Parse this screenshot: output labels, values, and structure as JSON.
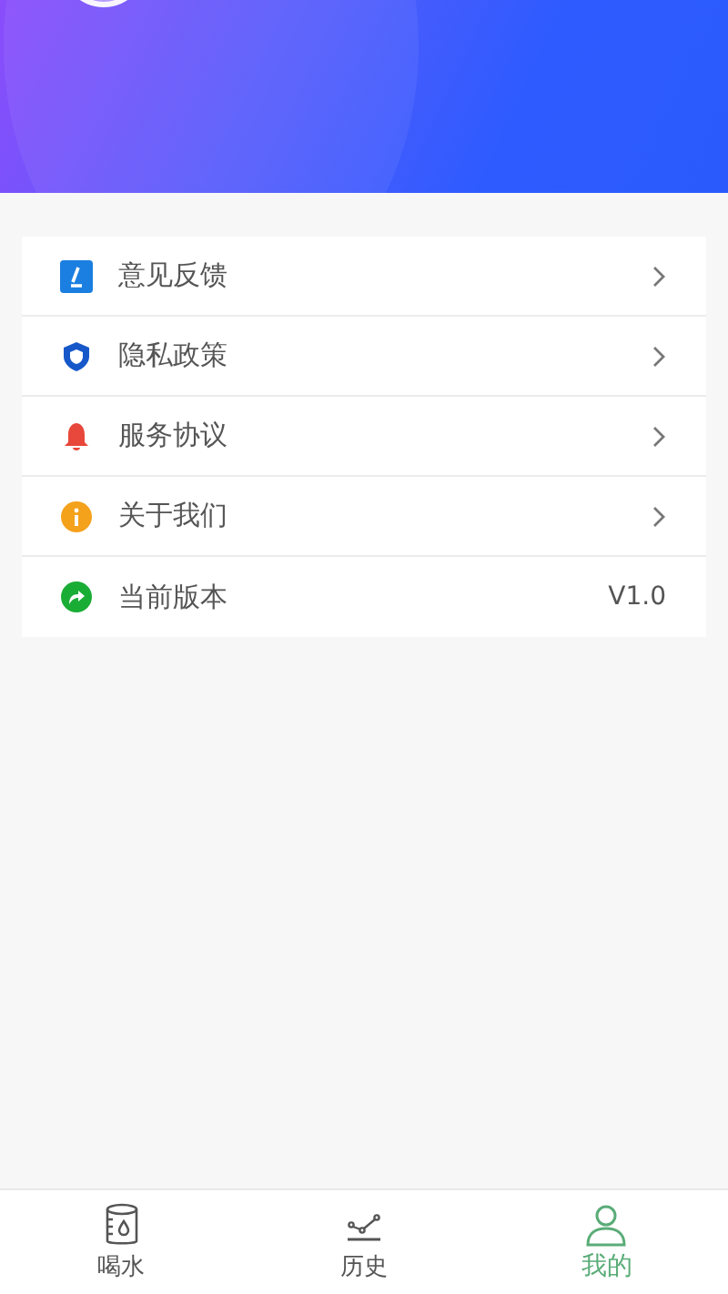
{
  "menu": [
    {
      "label": "意见反馈",
      "kind": "link"
    },
    {
      "label": "隐私政策",
      "kind": "link"
    },
    {
      "label": "服务协议",
      "kind": "link"
    },
    {
      "label": "关于我们",
      "kind": "link"
    },
    {
      "label": "当前版本",
      "kind": "value",
      "value": "V1.0"
    }
  ],
  "tabs": [
    {
      "label": "喝水",
      "selected": false
    },
    {
      "label": "历史",
      "selected": false
    },
    {
      "label": "我的",
      "selected": true
    }
  ]
}
